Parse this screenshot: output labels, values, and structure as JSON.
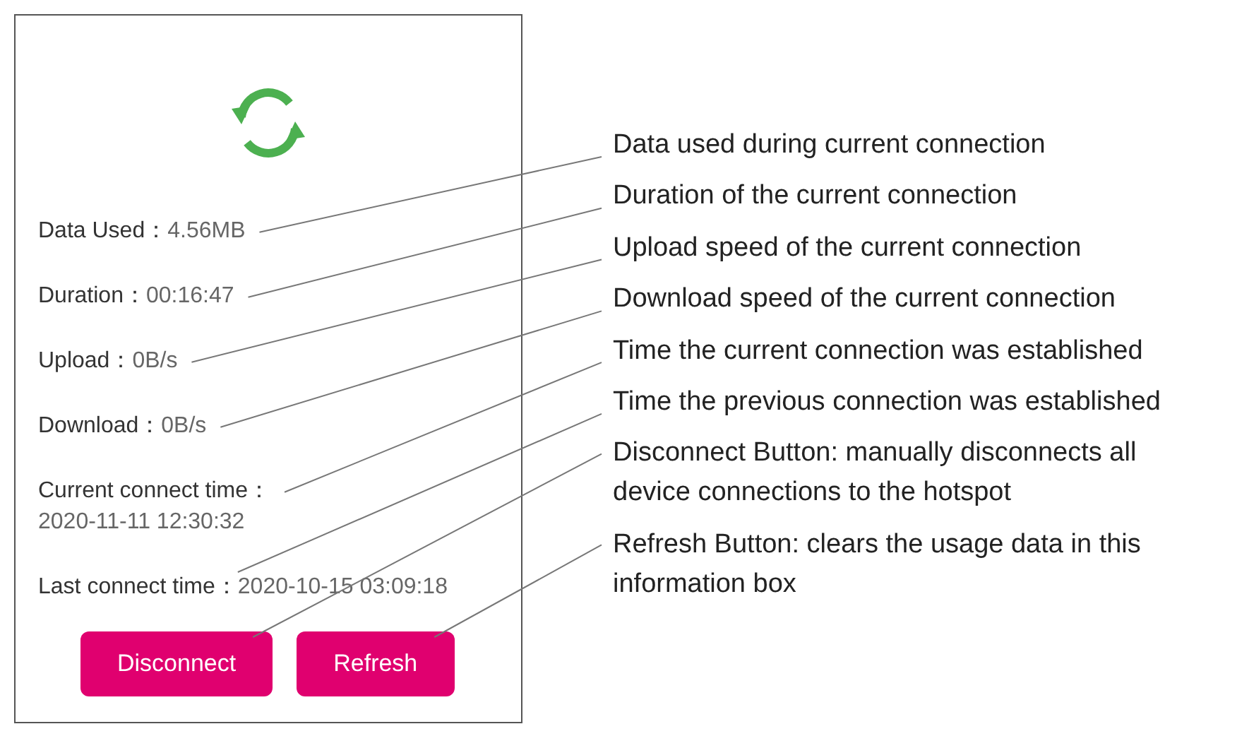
{
  "panel": {
    "rows": [
      {
        "label": "Data Used：",
        "value": "4.56MB",
        "kind": "inline"
      },
      {
        "label": "Duration：",
        "value": "00:16:47",
        "kind": "inline"
      },
      {
        "label": "Upload：",
        "value": "0B/s",
        "kind": "inline"
      },
      {
        "label": "Download：",
        "value": "0B/s",
        "kind": "inline"
      },
      {
        "label": "Current connect time：",
        "value": "2020-11-11 12:30:32",
        "kind": "stacked"
      },
      {
        "label": "Last connect time：",
        "value": "2020-10-15 03:09:18",
        "kind": "inline"
      }
    ],
    "buttons": [
      "Disconnect",
      "Refresh"
    ]
  },
  "callouts": [
    "Data used during current connection",
    "Duration of the current connection",
    "Upload speed of the current connection",
    "Download speed of the current connection",
    "Time the current connection was established",
    "Time the previous connection was established",
    "Disconnect Button: manually disconnects all device connections to the hotspot",
    "Refresh Button: clears the usage data in this information box"
  ]
}
